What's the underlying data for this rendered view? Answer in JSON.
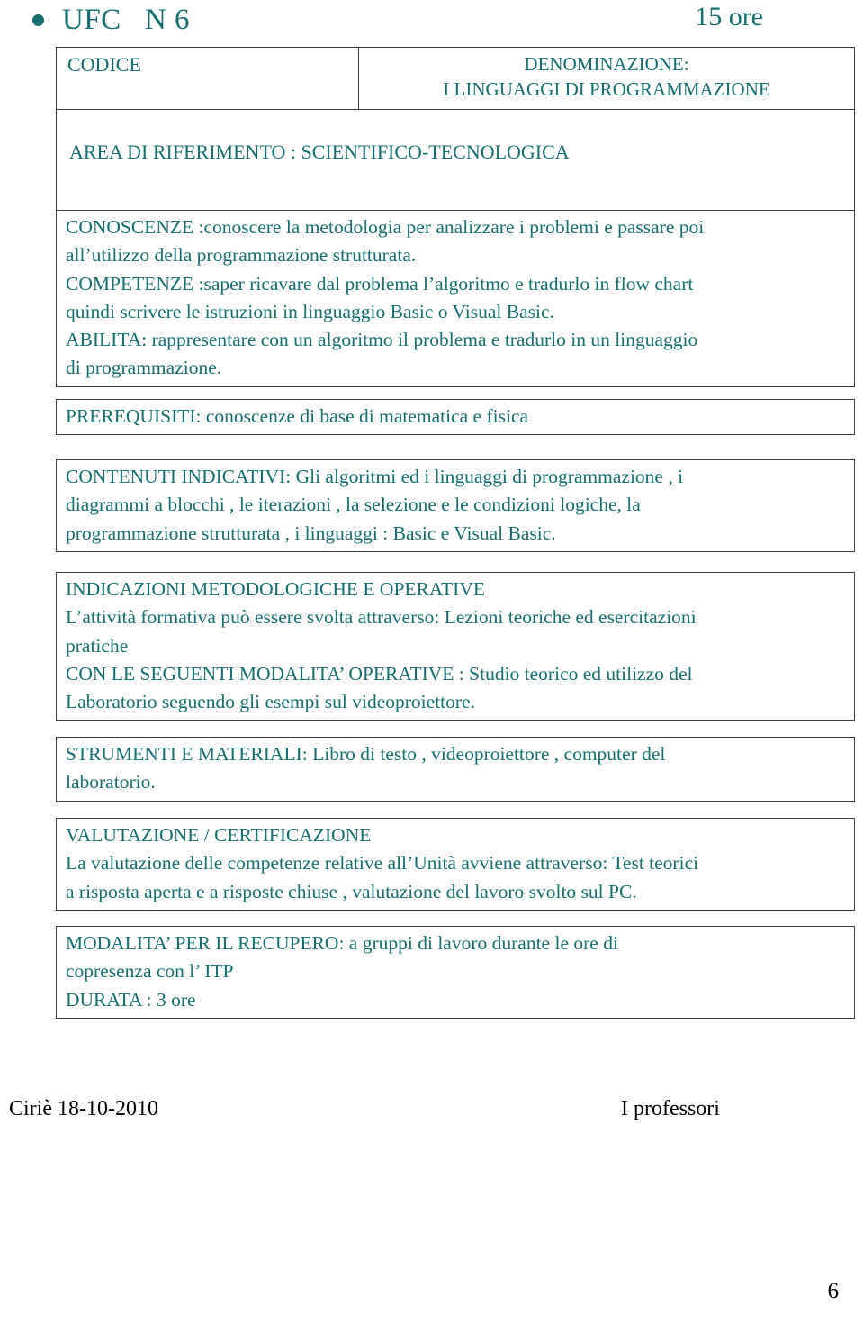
{
  "header": {
    "bullet_icon": "bullet-dot-icon",
    "title": "UFC   N 6",
    "hours": "15 ore"
  },
  "top_table": {
    "codice_label": "CODICE",
    "denominazione_label": "DENOMINAZIONE:",
    "denominazione_value": "I LINGUAGGI DI PROGRAMMAZIONE",
    "area_label": "AREA DI RIFERIMENTO : SCIENTIFICO-TECNOLOGICA"
  },
  "sections": {
    "conoscenze": {
      "line1": "CONOSCENZE :conoscere la metodologia per analizzare i problemi e passare poi",
      "line2": "all’utilizzo della programmazione strutturata.",
      "line3": "COMPETENZE :saper ricavare dal problema l’algoritmo e tradurlo in flow chart",
      "line4": "quindi scrivere le istruzioni in linguaggio Basic o Visual Basic.",
      "line5": "ABILITA: rappresentare con un algoritmo il problema e tradurlo  in un linguaggio",
      "line6": "di programmazione."
    },
    "prerequisiti": {
      "line1": "PREREQUISITI: conoscenze di base di matematica e fisica"
    },
    "contenuti": {
      "line1": "CONTENUTI INDICATIVI: Gli algoritmi ed i linguaggi di programmazione , i",
      "line2": "diagrammi a blocchi , le iterazioni , la selezione e le condizioni logiche, la",
      "line3": "programmazione strutturata , i linguaggi : Basic e Visual Basic."
    },
    "indicazioni": {
      "line1": "INDICAZIONI METODOLOGICHE E OPERATIVE",
      "line2": "L’attività formativa può essere svolta attraverso: Lezioni teoriche ed esercitazioni",
      "line3": "pratiche",
      "line4": "CON LE SEGUENTI MODALITA’ OPERATIVE : Studio teorico ed utilizzo del",
      "line5": "Laboratorio seguendo gli esempi sul videoproiettore."
    },
    "strumenti": {
      "line1": "STRUMENTI E MATERIALI: Libro di testo , videoproiettore ,  computer del",
      "line2": "laboratorio."
    },
    "valutazione": {
      "line1": "VALUTAZIONE / CERTIFICAZIONE",
      "line2": "La valutazione delle competenze relative all’Unità avviene attraverso: Test teorici",
      "line3": "a risposta aperta e a risposte chiuse , valutazione del lavoro svolto sul PC."
    },
    "modalita": {
      "line1": "MODALITA’ PER IL RECUPERO: a gruppi di lavoro durante le ore di",
      "line2": "copresenza con l’ ITP",
      "line3": "DURATA : 3 ore"
    }
  },
  "footer": {
    "date": "Ciriè 18-10-2010",
    "signature": "I professori",
    "page_number": "6"
  },
  "colors": {
    "text_teal": "#14706e",
    "border_gray": "#3d3d3d",
    "footer_black": "#000000"
  }
}
